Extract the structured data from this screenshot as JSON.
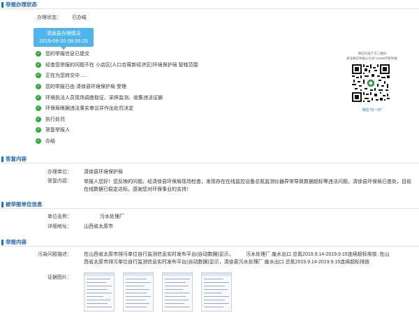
{
  "sections": {
    "status": "举报办理状态",
    "reply": "答复内容",
    "reported": "被举报单位信息",
    "report": "举报内容"
  },
  "status": {
    "label": "办理状态：",
    "value": "已办结"
  },
  "progress_box": {
    "title": "清徐县办理情况",
    "datetime": "2019-09-20 09:26:25"
  },
  "steps": [
    "您的举报信息已提交",
    "经查您举报的问题不在 小店区(人口合蒋新经济区)环境保护局 管辖范围",
    "正在为您转交中.....",
    "您的举报已由 清徐县环境保护局 受理",
    "环境执法人员现场调查取证、采样监测、收集违法证据",
    "环保局根据违法事实审议并作出处罚决定",
    "执行处罚",
    "答复举报人",
    "办结"
  ],
  "qr": {
    "caption1": "微信扫描下方二维码",
    "caption2": "关注微信举报公众号\"12369环保举报\"",
    "scan_text": "微信\"扫一扫\""
  },
  "reply": {
    "unit_label": "办理单位：",
    "unit_value": "清徐县环境保护局",
    "content_label": "答复内容：",
    "content_value": "举报人您好！您反映的问题，经清徐县环保局现场检查，发现存在在线监控设备总氮监测仪器异常导致数据超标等违法问题，清徐县环保局已查处，目前在线数据已稳定达标。感谢您对环保事业的支持！"
  },
  "reported": {
    "name_label": "单位名称：",
    "name_value": "污水处理厂",
    "address_label": "详细地址：",
    "address_value": "山西省太原市"
  },
  "report": {
    "issue_label": "污染问题描述：",
    "issue_value": "在山西省太原市排污单位自行监测信息实时发布平台(自动数据)显示，　　　污水处理厂 废水出口 总氮2019.9.14-2019.9.15连续超标排放. 在山西省太原市排污单位自行监测信息实时发布平台(自动数据)显示，清徐县污水处理厂 废水出口 总氮2019.9.14-2019.9.15连续超标排放",
    "evidence_label": "证据图片："
  },
  "colors": {
    "accent": "#1e6fc8",
    "date_box": "#4fb5ec",
    "check": "#2faa35"
  }
}
